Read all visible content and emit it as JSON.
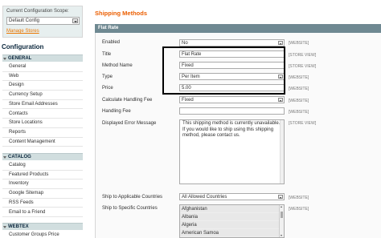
{
  "sidebar": {
    "scope_label": "Current Configuration Scope:",
    "scope_value": "Default Config",
    "manage_stores": "Manage Stores",
    "config_title": "Configuration",
    "groups": [
      {
        "label": "GENERAL",
        "items": [
          "General",
          "Web",
          "Design",
          "Currency Setup",
          "Store Email Addresses",
          "Contacts",
          "Store Locations",
          "Reports",
          "Content Management"
        ]
      },
      {
        "label": "CATALOG",
        "items": [
          "Catalog",
          "Featured Products",
          "Inventory",
          "Google Sitemap",
          "RSS Feeds",
          "Email to a Friend"
        ]
      },
      {
        "label": "WEBTEX",
        "items": [
          "Customer Groups Price"
        ]
      }
    ]
  },
  "main": {
    "page_title": "Shipping Methods",
    "section_title": "Flat Rate",
    "fields": {
      "enabled": {
        "label": "Enabled",
        "value": "No",
        "scope": "[WEBSITE]"
      },
      "title": {
        "label": "Title",
        "value": "Flat Rate",
        "scope": "[STORE VIEW]"
      },
      "method_name": {
        "label": "Method Name",
        "value": "Fixed",
        "scope": "[STORE VIEW]"
      },
      "type": {
        "label": "Type",
        "value": "Per Item",
        "scope": "[WEBSITE]"
      },
      "price": {
        "label": "Price",
        "value": "5.00",
        "scope": "[WEBSITE]"
      },
      "calc_handling_fee": {
        "label": "Calculate Handling Fee",
        "value": "Fixed",
        "scope": "[WEBSITE]"
      },
      "handling_fee": {
        "label": "Handling Fee",
        "value": "",
        "scope": "[WEBSITE]"
      },
      "error_message": {
        "label": "Displayed Error Message",
        "value": "This shipping method is currently unavailable. If you would like to ship using this shipping method, please contact us.",
        "scope": "[STORE VIEW]"
      },
      "ship_applicable": {
        "label": "Ship to Applicable Countries",
        "value": "All Allowed Countries",
        "scope": "[WEBSITE]"
      },
      "ship_specific": {
        "label": "Ship to Specific Countries",
        "options": [
          "Afghanistan",
          "Albania",
          "Algeria",
          "American Samoa"
        ],
        "scope": "[WEBSITE]"
      }
    }
  }
}
